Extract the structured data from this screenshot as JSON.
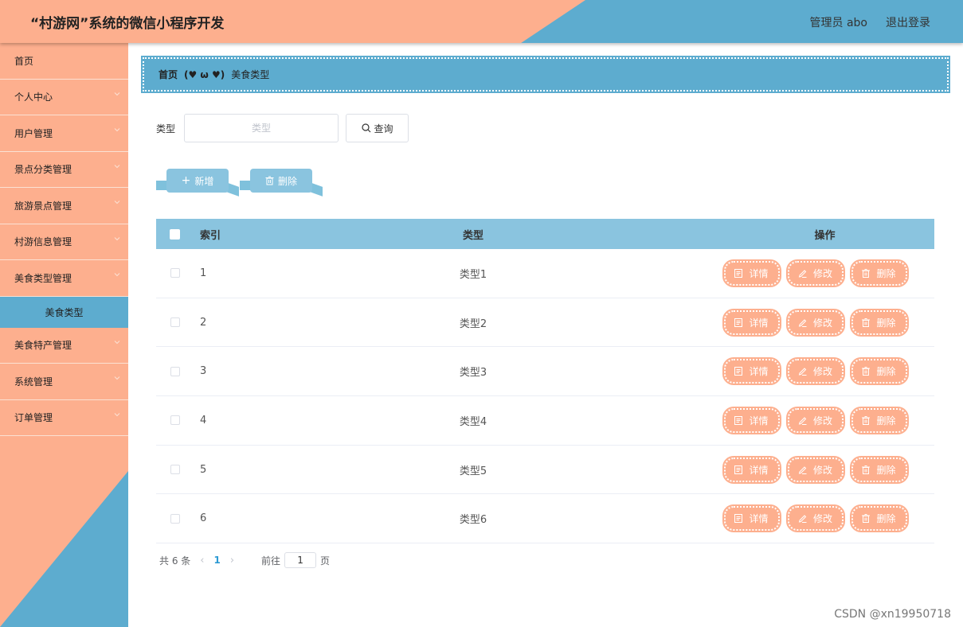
{
  "header": {
    "title": "“村游网”系统的微信小程序开发",
    "admin_label": "管理员 abo",
    "logout_label": "退出登录"
  },
  "sidebar": {
    "items": [
      {
        "label": "首页",
        "has_chevron": false
      },
      {
        "label": "个人中心",
        "has_chevron": true
      },
      {
        "label": "用户管理",
        "has_chevron": true
      },
      {
        "label": "景点分类管理",
        "has_chevron": true
      },
      {
        "label": "旅游景点管理",
        "has_chevron": true
      },
      {
        "label": "村游信息管理",
        "has_chevron": true
      },
      {
        "label": "美食类型管理",
        "has_chevron": true
      }
    ],
    "active_sub": "美食类型",
    "items_after": [
      {
        "label": "美食特产管理",
        "has_chevron": true
      },
      {
        "label": "系统管理",
        "has_chevron": true
      },
      {
        "label": "订单管理",
        "has_chevron": true
      }
    ]
  },
  "breadcrumb": {
    "home": "首页",
    "separator": "(♥ ω ♥)",
    "current": "美食类型"
  },
  "search": {
    "label": "类型",
    "placeholder": "类型",
    "value": "",
    "button_label": "查询"
  },
  "actions": {
    "add_label": "新增",
    "delete_label": "删除"
  },
  "table": {
    "headers": {
      "index": "索引",
      "type": "类型",
      "ops": "操作"
    },
    "rows": [
      {
        "index": "1",
        "type": "类型1"
      },
      {
        "index": "2",
        "type": "类型2"
      },
      {
        "index": "3",
        "type": "类型3"
      },
      {
        "index": "4",
        "type": "类型4"
      },
      {
        "index": "5",
        "type": "类型5"
      },
      {
        "index": "6",
        "type": "类型6"
      }
    ],
    "row_actions": {
      "detail": "详情",
      "edit": "修改",
      "delete": "删除"
    }
  },
  "pager": {
    "total": "共 6 条",
    "current_page": "1",
    "goto_label": "前往",
    "goto_value": "1",
    "page_suffix": "页"
  },
  "watermark": "CSDN @xn19950718",
  "colors": {
    "salmon": "#fdaf8e",
    "blue": "#5daccf",
    "light_blue": "#8ac4df"
  }
}
